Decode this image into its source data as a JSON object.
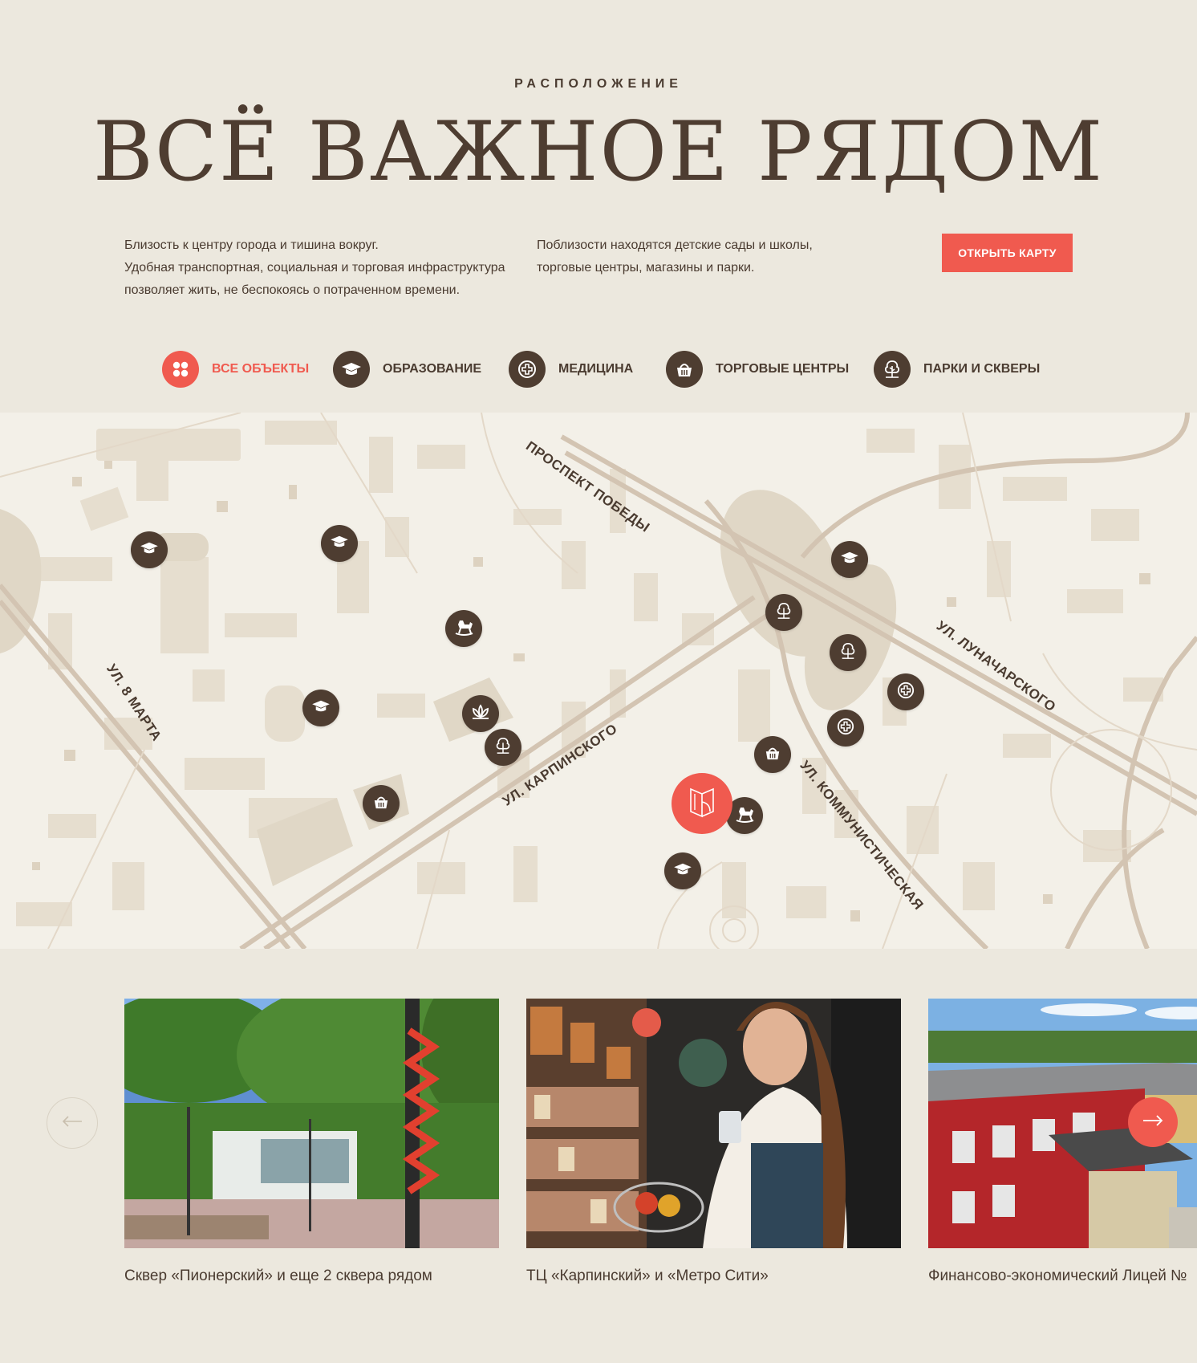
{
  "header": {
    "eyebrow": "РАСПОЛОЖЕНИЕ",
    "title": "ВСЁ ВАЖНОЕ РЯДОМ"
  },
  "intro": {
    "left_lines": [
      "Близость к центру города и тишина вокруг.",
      "Удобная транспортная, социальная и торговая инфраструктура",
      "позволяет жить, не беспокоясь о потраченном времени."
    ],
    "right_lines": [
      "Поблизости находятся детские сады и школы,",
      "торговые центры, магазины и парки."
    ],
    "cta_label": "ОТКРЫТЬ КАРТУ"
  },
  "filters": [
    {
      "label": "ВСЕ ОБЪЕКТЫ",
      "icon": "grid-icon",
      "active": true
    },
    {
      "label": "ОБРАЗОВАНИЕ",
      "icon": "graduation-cap-icon",
      "active": false
    },
    {
      "label": "МЕДИЦИНА",
      "icon": "medical-cross-icon",
      "active": false
    },
    {
      "label": "ТОРГОВЫЕ ЦЕНТРЫ",
      "icon": "shopping-basket-icon",
      "active": false
    },
    {
      "label": "ПАРКИ И СКВЕРЫ",
      "icon": "tree-icon",
      "active": false
    }
  ],
  "map": {
    "streets": [
      "ПРОСПЕКТ ПОБЕДЫ",
      "УЛ. ЛУНАЧАРСКОГО",
      "УЛ. 8 МАРТА",
      "УЛ. КАРПИНСКОГО",
      "УЛ. КОММУНИСТИЧЕСКАЯ"
    ],
    "pins": [
      {
        "category": "education",
        "icon": "graduation-cap-icon"
      },
      {
        "category": "education",
        "icon": "graduation-cap-icon"
      },
      {
        "category": "education",
        "icon": "graduation-cap-icon"
      },
      {
        "category": "education",
        "icon": "graduation-cap-icon"
      },
      {
        "category": "education",
        "icon": "graduation-cap-icon"
      },
      {
        "category": "kindergarten",
        "icon": "rocking-horse-icon"
      },
      {
        "category": "kindergarten",
        "icon": "rocking-horse-icon"
      },
      {
        "category": "park",
        "icon": "lotus-icon"
      },
      {
        "category": "park",
        "icon": "tree-icon"
      },
      {
        "category": "park",
        "icon": "tree-icon"
      },
      {
        "category": "park",
        "icon": "tree-icon"
      },
      {
        "category": "medicine",
        "icon": "medical-cross-icon"
      },
      {
        "category": "medicine",
        "icon": "medical-cross-icon"
      },
      {
        "category": "shopping",
        "icon": "shopping-basket-icon"
      },
      {
        "category": "shopping",
        "icon": "shopping-basket-icon"
      }
    ],
    "home_icon": "residential-complex-logo-icon"
  },
  "cards": [
    {
      "caption": "Сквер «Пионерский»  и еще 2 сквера рядом"
    },
    {
      "caption": "ТЦ «Карпинский» и «Метро Сити»"
    },
    {
      "caption": "Финансово-экономический Лицей №"
    }
  ],
  "colors": {
    "accent": "#f05a4f",
    "dark": "#4e3d31",
    "background": "#ece8de",
    "map_bg": "#f3f0e8",
    "block": "#e0d7c6"
  }
}
